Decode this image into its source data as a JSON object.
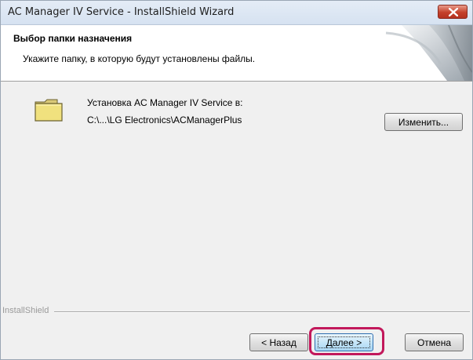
{
  "window": {
    "title": "AC Manager IV Service - InstallShield Wizard"
  },
  "header": {
    "title": "Выбор папки назначения",
    "subtitle": "Укажите папку, в которую будут установлены файлы."
  },
  "main": {
    "install_label": "Установка AC Manager IV Service в:",
    "install_path": "C:\\...\\LG Electronics\\ACManagerPlus",
    "change_button": "Изменить..."
  },
  "footer": {
    "brand": "InstallShield",
    "back_button": "< Назад",
    "next_button": "Далее >",
    "cancel_button": "Отмена"
  },
  "icons": {
    "close": "close-icon",
    "folder": "folder-icon"
  },
  "colors": {
    "highlight": "#c2185b",
    "close_button": "#c4402a"
  }
}
